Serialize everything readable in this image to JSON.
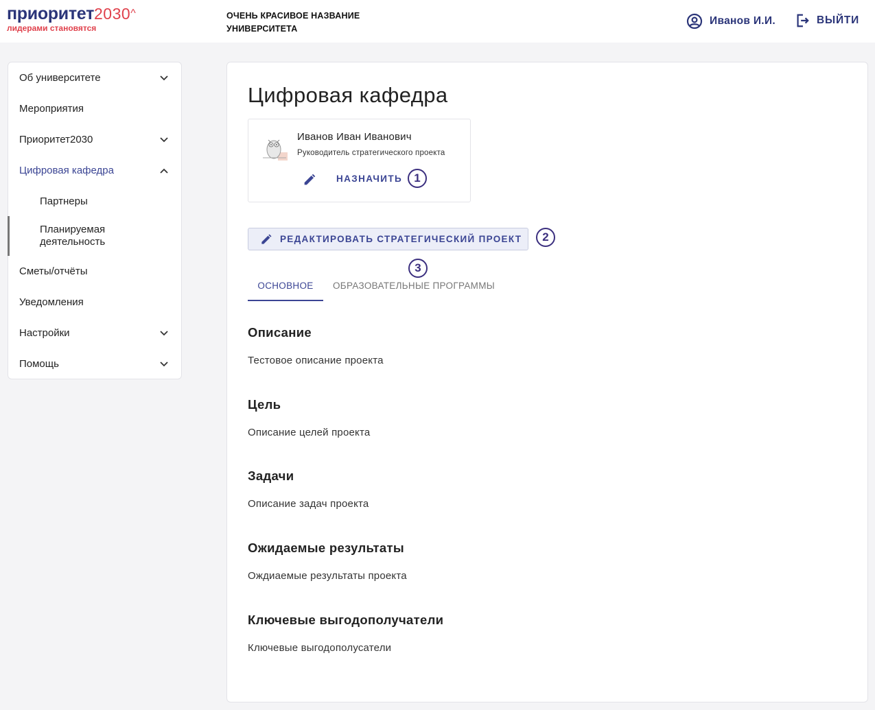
{
  "header": {
    "logo_main": "приоритет",
    "logo_num": "2030",
    "logo_caret": "^",
    "logo_sub": "лидерами становятся",
    "university_name": "Очень красивое название университета",
    "user_name": "Иванов И.И.",
    "logout_label": "ВЫЙТИ"
  },
  "sidebar": {
    "items": [
      {
        "label": "Об университете"
      },
      {
        "label": "Мероприятия"
      },
      {
        "label": "Приоритет2030"
      },
      {
        "label": "Цифровая кафедра"
      },
      {
        "label": "Партнеры"
      },
      {
        "label": "Планируемая деятельность"
      },
      {
        "label": "Сметы/отчёты"
      },
      {
        "label": "Уведомления"
      },
      {
        "label": "Настройки"
      },
      {
        "label": "Помощь"
      }
    ]
  },
  "main": {
    "title": "Цифровая кафедра",
    "person": {
      "name": "Иванов Иван Иванович",
      "role": "Руководитель стратегического проекта",
      "assign_label": "НАЗНАЧИТЬ"
    },
    "edit_project_label": "РЕДАКТИРОВАТЬ СТРАТЕГИЧЕСКИЙ ПРОЕКТ",
    "markers": [
      "1",
      "2",
      "3"
    ],
    "tabs": [
      {
        "label": "ОСНОВНОЕ",
        "active": true
      },
      {
        "label": "ОБРАЗОВАТЕЛЬНЫЕ ПРОГРАММЫ",
        "active": false
      }
    ],
    "sections": [
      {
        "title": "Описание",
        "text": "Тестовое описание проекта"
      },
      {
        "title": "Цель",
        "text": "Описание целей проекта"
      },
      {
        "title": "Задачи",
        "text": "Описание задач проекта"
      },
      {
        "title": "Ожидаемые результаты",
        "text": "Ождиаемые результаты проекта"
      },
      {
        "title": "Ключевые выгодополучатели",
        "text": "Ключевые выгодополусатели"
      }
    ]
  },
  "colors": {
    "brand_blue": "#2b3579",
    "brand_red": "#e0414c",
    "accent": "#3b4594"
  },
  "icons": {
    "user": "user-circle-icon",
    "logout": "logout-icon",
    "chevron_down": "chevron-down-icon",
    "chevron_up": "chevron-up-icon",
    "edit": "pencil-icon",
    "avatar": "owl-avatar"
  }
}
